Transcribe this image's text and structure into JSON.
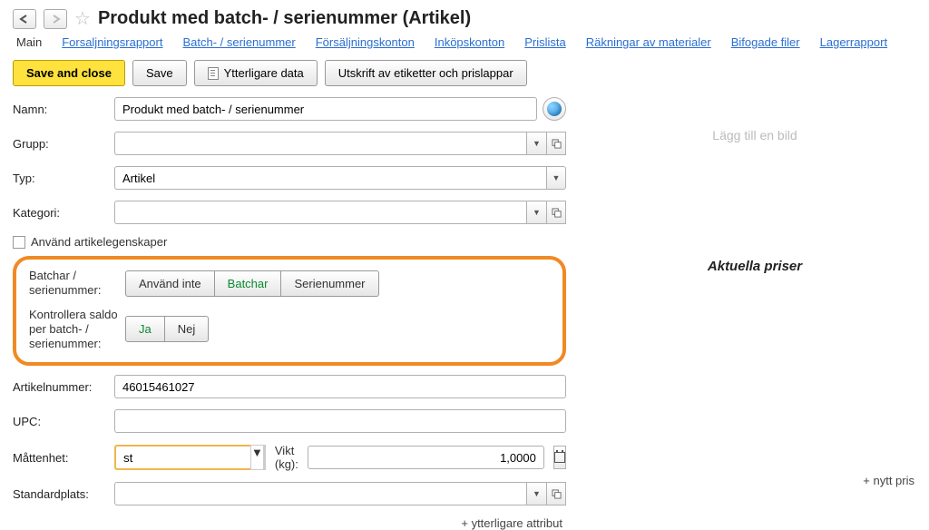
{
  "header": {
    "title": "Produkt med batch- / serienummer (Artikel)"
  },
  "tabs": [
    "Main",
    "Forsaljningsrapport",
    "Batch- / serienummer",
    "Försäljningskonton",
    "Inköpskonton",
    "Prislista",
    "Räkningar av materialer",
    "Bifogade filer",
    "Lagerrapport"
  ],
  "toolbar": {
    "save_close": "Save and close",
    "save": "Save",
    "more_data": "Ytterligare data",
    "print_labels": "Utskrift av etiketter och prislappar"
  },
  "labels": {
    "name": "Namn:",
    "group": "Grupp:",
    "type": "Typ:",
    "category": "Kategori:",
    "use_props": "Använd artikelegenskaper",
    "batch": "Batchar / serienummer:",
    "control": "Kontrollera saldo per batch- / serienummer:",
    "art_no": "Artikelnummer:",
    "upc": "UPC:",
    "uom": "Måttenhet:",
    "weight": "Vikt (kg):",
    "loc": "Standardplats:",
    "more_attr": "+ ytterligare attribut"
  },
  "values": {
    "name": "Produkt med batch- / serienummer",
    "group": "",
    "type": "Artikel",
    "category": "",
    "art_no": "46015461027",
    "upc": "",
    "uom": "st",
    "weight": "1,0000",
    "loc": ""
  },
  "seg_batch": {
    "a": "Använd inte",
    "b": "Batchar",
    "c": "Serienummer"
  },
  "seg_yn": {
    "yes": "Ja",
    "no": "Nej"
  },
  "right": {
    "add_image": "Lägg till en bild",
    "prices_title": "Aktuella priser",
    "new_price": "+ nytt pris"
  }
}
